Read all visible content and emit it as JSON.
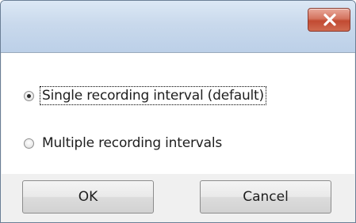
{
  "titlebar": {
    "close_icon": "close-icon"
  },
  "options": {
    "single_label": "Single recording interval (default)",
    "multiple_label": "Multiple recording intervals",
    "selected": "single"
  },
  "buttons": {
    "ok_label": "OK",
    "cancel_label": "Cancel"
  },
  "colors": {
    "close_button": "#c24a32",
    "titlebar": "#c9d9ec",
    "dialog_background": "#f0f0f0"
  }
}
